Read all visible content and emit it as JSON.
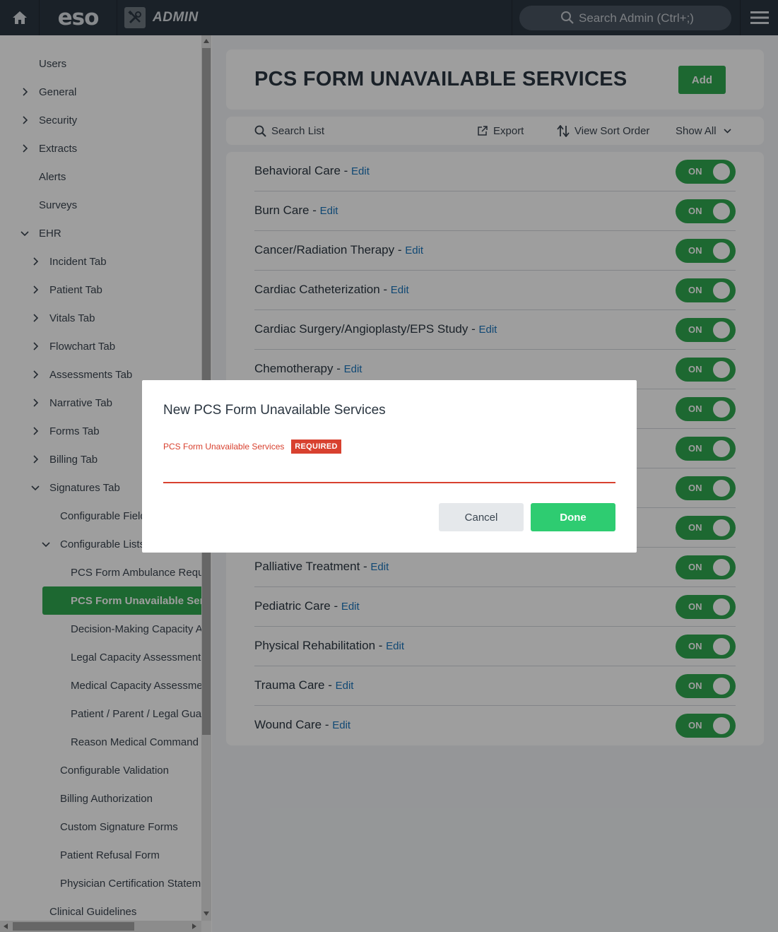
{
  "topbar": {
    "logo": "eso",
    "admin_label": "ADMIN",
    "search_placeholder": "Search Admin (Ctrl+;)"
  },
  "sidebar": {
    "items": [
      {
        "label": "Users",
        "chevron": "none"
      },
      {
        "label": "General",
        "chevron": "right"
      },
      {
        "label": "Security",
        "chevron": "right"
      },
      {
        "label": "Extracts",
        "chevron": "right"
      },
      {
        "label": "Alerts",
        "chevron": "none"
      },
      {
        "label": "Surveys",
        "chevron": "none"
      },
      {
        "label": "EHR",
        "chevron": "down"
      },
      {
        "label": "Incident Tab",
        "chevron": "right"
      },
      {
        "label": "Patient Tab",
        "chevron": "right"
      },
      {
        "label": "Vitals Tab",
        "chevron": "right"
      },
      {
        "label": "Flowchart Tab",
        "chevron": "right"
      },
      {
        "label": "Assessments Tab",
        "chevron": "right"
      },
      {
        "label": "Narrative Tab",
        "chevron": "right"
      },
      {
        "label": "Forms Tab",
        "chevron": "right"
      },
      {
        "label": "Billing Tab",
        "chevron": "right"
      },
      {
        "label": "Signatures Tab",
        "chevron": "down"
      },
      {
        "label": "Configurable Fields",
        "chevron": "none"
      },
      {
        "label": "Configurable Lists",
        "chevron": "down"
      },
      {
        "label": "PCS Form Ambulance Requirements",
        "chevron": "none"
      },
      {
        "label": "PCS Form Unavailable Services",
        "chevron": "none",
        "active": true
      },
      {
        "label": "Decision-Making Capacity Assessment",
        "chevron": "none"
      },
      {
        "label": "Legal Capacity Assessment",
        "chevron": "none"
      },
      {
        "label": "Medical Capacity Assessment",
        "chevron": "none"
      },
      {
        "label": "Patient / Parent / Legal Guardian",
        "chevron": "none"
      },
      {
        "label": "Reason Medical Command Not",
        "chevron": "none"
      },
      {
        "label": "Configurable Validation",
        "chevron": "none"
      },
      {
        "label": "Billing Authorization",
        "chevron": "none"
      },
      {
        "label": "Custom Signature Forms",
        "chevron": "none"
      },
      {
        "label": "Patient Refusal Form",
        "chevron": "none"
      },
      {
        "label": "Physician Certification Statement",
        "chevron": "none"
      },
      {
        "label": "Clinical Guidelines",
        "chevron": "none"
      }
    ]
  },
  "main": {
    "title": "PCS FORM UNAVAILABLE SERVICES",
    "add_label": "Add",
    "toolbar": {
      "search": "Search List",
      "export": "Export",
      "sort": "View Sort Order",
      "filter": "Show All"
    },
    "edit_label": "Edit",
    "toggle_label": "ON",
    "rows": [
      "Behavioral Care",
      "Burn Care",
      "Cancer/Radiation Therapy",
      "Cardiac Catheterization",
      "Cardiac Surgery/Angioplasty/EPS Study",
      "Chemotherapy",
      "",
      "",
      "",
      "",
      "Palliative Treatment",
      "Pediatric Care",
      "Physical Rehabilitation",
      "Trauma Care",
      "Wound Care"
    ]
  },
  "modal": {
    "title": "New PCS Form Unavailable Services",
    "field_label": "PCS Form Unavailable Services",
    "required_badge": "REQUIRED",
    "field_value": "",
    "cancel_label": "Cancel",
    "done_label": "Done"
  },
  "colors": {
    "topbar": "#2b3641",
    "accent_green": "#2fa84f",
    "done_green": "#2ecc71",
    "required_red": "#d8412f",
    "link_blue": "#1b75bc"
  }
}
